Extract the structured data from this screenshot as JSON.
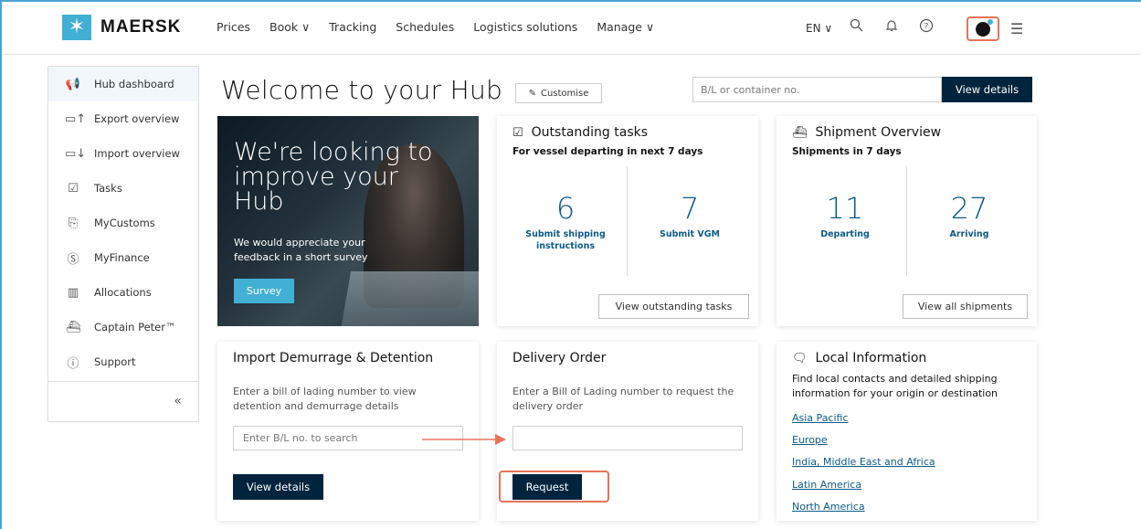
{
  "nav": {
    "brand": "MAERSK",
    "links": [
      "Prices",
      "Book ∨",
      "Tracking",
      "Schedules",
      "Logistics solutions",
      "Manage ∨"
    ],
    "language": "EN ∨",
    "icons": [
      "search-icon",
      "bell-icon",
      "help-icon",
      "user-icon",
      "menu-icon"
    ]
  },
  "sidebar": {
    "items": [
      {
        "label": "Hub dashboard",
        "icon": "megaphone-icon",
        "glyph": "📢"
      },
      {
        "label": "Export overview",
        "icon": "export-icon",
        "glyph": "▭↑"
      },
      {
        "label": "Import overview",
        "icon": "import-icon",
        "glyph": "▭↓"
      },
      {
        "label": "Tasks",
        "icon": "checkbox-icon",
        "glyph": "☑"
      },
      {
        "label": "MyCustoms",
        "icon": "customs-icon",
        "glyph": "⎘"
      },
      {
        "label": "MyFinance",
        "icon": "finance-icon",
        "glyph": "Ⓢ"
      },
      {
        "label": "Allocations",
        "icon": "bar-chart-icon",
        "glyph": "▥"
      },
      {
        "label": "Captain Peter™",
        "icon": "captain-icon",
        "glyph": "⛴"
      },
      {
        "label": "Support",
        "icon": "info-icon",
        "glyph": "ⓘ"
      }
    ],
    "collapse_glyph": "«"
  },
  "header": {
    "title": "Welcome to your Hub",
    "customise_label": "Customise",
    "search_placeholder": "B/L or container no.",
    "search_button": "View details"
  },
  "banner": {
    "title": "We're looking to improve your Hub",
    "text": "We would appreciate your feedback in a short survey",
    "button": "Survey"
  },
  "tasks": {
    "title": "Outstanding tasks",
    "subtitle": "For vessel departing in next 7 days",
    "count1": "6",
    "label1": "Submit shipping instructions",
    "count2": "7",
    "label2": "Submit VGM",
    "button": "View outstanding tasks"
  },
  "shipments": {
    "title": "Shipment Overview",
    "subtitle": "Shipments in 7 days",
    "count1": "11",
    "label1": "Departing",
    "count2": "27",
    "label2": "Arriving",
    "button": "View all shipments"
  },
  "demurrage": {
    "title": "Import Demurrage & Detention",
    "desc": "Enter a bill of lading number to view detention and demurrage details",
    "placeholder": "Enter B/L no. to search",
    "button": "View details"
  },
  "delivery": {
    "title": "Delivery Order",
    "desc": "Enter a Bill of Lading number to request the delivery order",
    "value": "",
    "button": "Request"
  },
  "local": {
    "title": "Local Information",
    "desc": "Find local contacts and detailed shipping information for your origin or destination",
    "regions": [
      "Asia Pacific",
      "Europe",
      "India, Middle East and Africa",
      "Latin America",
      "North America"
    ]
  },
  "colors": {
    "brand_blue": "#42b0d5",
    "dark_navy": "#00243d",
    "link_blue": "#0b5a8a",
    "highlight": "#e8735a"
  }
}
